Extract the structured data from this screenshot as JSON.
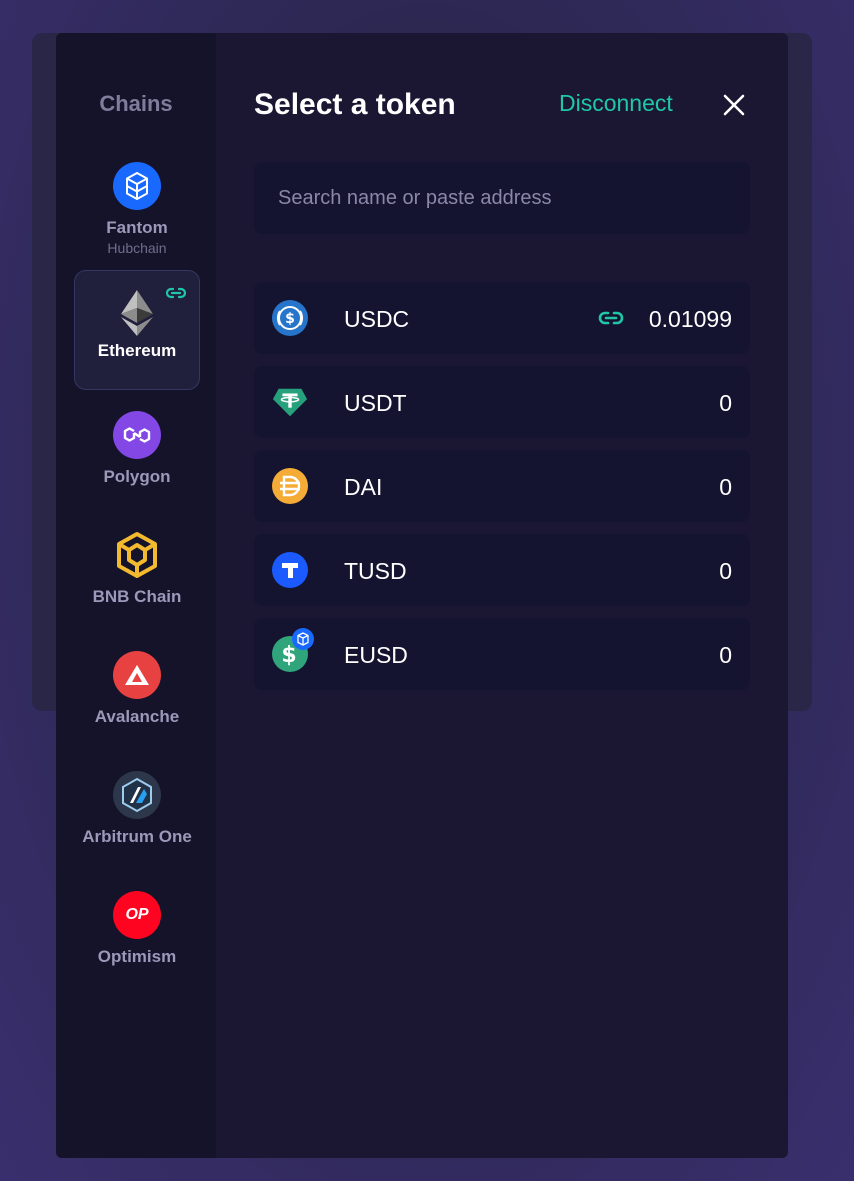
{
  "modal": {
    "title": "Select a token",
    "disconnect_label": "Disconnect",
    "close_icon": "close-icon",
    "accent_color": "#1fc7a7"
  },
  "sidebar": {
    "title": "Chains",
    "selected": "Ethereum",
    "chains": [
      {
        "name": "Fantom",
        "subtitle": "Hubchain",
        "icon": "fantom-icon",
        "color": "#1969ff"
      },
      {
        "name": "Ethereum",
        "icon": "ethereum-icon",
        "color": "#8a92b2",
        "linked": true
      },
      {
        "name": "Polygon",
        "icon": "polygon-icon",
        "color": "#8247e5"
      },
      {
        "name": "BNB Chain",
        "icon": "bnb-icon",
        "color": "#f3ba2f"
      },
      {
        "name": "Avalanche",
        "icon": "avalanche-icon",
        "color": "#e84142"
      },
      {
        "name": "Arbitrum One",
        "icon": "arbitrum-icon",
        "color": "#2d374b"
      },
      {
        "name": "Optimism",
        "icon": "optimism-icon",
        "color": "#ff0420",
        "icon_text": "OP"
      }
    ]
  },
  "search": {
    "placeholder": "Search name or paste address",
    "value": ""
  },
  "tokens": [
    {
      "symbol": "USDC",
      "balance": "0.01099",
      "icon": "usdc-icon",
      "color": "#2775ca",
      "linked": true
    },
    {
      "symbol": "USDT",
      "balance": "0",
      "icon": "usdt-icon",
      "color": "#26a17b"
    },
    {
      "symbol": "DAI",
      "balance": "0",
      "icon": "dai-icon",
      "color": "#f5ac37"
    },
    {
      "symbol": "TUSD",
      "balance": "0",
      "icon": "tusd-icon",
      "color": "#1a5aff"
    },
    {
      "symbol": "EUSD",
      "balance": "0",
      "icon": "eusd-icon",
      "color": "#30a57b"
    }
  ]
}
